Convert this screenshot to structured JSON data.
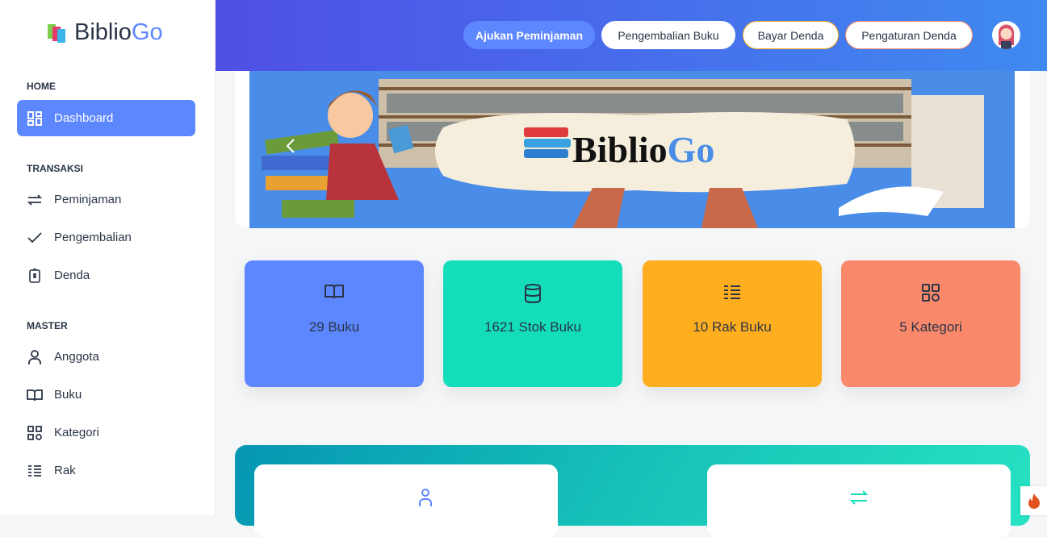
{
  "brand": {
    "name_a": "Biblio",
    "name_b": "Go"
  },
  "sidebar": {
    "sections": [
      {
        "title": "HOME",
        "items": [
          {
            "label": "Dashboard",
            "icon": "dashboard-icon",
            "active": true
          }
        ]
      },
      {
        "title": "TRANSAKSI",
        "items": [
          {
            "label": "Peminjaman",
            "icon": "arrows-exchange-icon"
          },
          {
            "label": "Pengembalian",
            "icon": "check-icon"
          },
          {
            "label": "Denda",
            "icon": "receipt-dollar-icon"
          }
        ]
      },
      {
        "title": "MASTER",
        "items": [
          {
            "label": "Anggota",
            "icon": "user-icon"
          },
          {
            "label": "Buku",
            "icon": "book-icon"
          },
          {
            "label": "Kategori",
            "icon": "category-icon"
          },
          {
            "label": "Rak",
            "icon": "list-icon"
          }
        ]
      }
    ]
  },
  "topbar": {
    "buttons": [
      "Ajukan Peminjaman",
      "Pengembalian Buku",
      "Bayar Denda",
      "Pengaturan Denda"
    ]
  },
  "banner": {
    "logo_text": "BiblioGo"
  },
  "stats": [
    {
      "label": "29 Buku",
      "icon": "book-icon",
      "color": "#5d87ff"
    },
    {
      "label": "1621 Stok Buku",
      "icon": "database-icon",
      "color": "#13deb9"
    },
    {
      "label": "10 Rak Buku",
      "icon": "list-icon",
      "color": "#ffae1f"
    },
    {
      "label": "5 Kategori",
      "icon": "category-icon",
      "color": "#fa896b"
    }
  ],
  "colors": {
    "accent": "#5d87ff",
    "text": "#2a3547"
  }
}
